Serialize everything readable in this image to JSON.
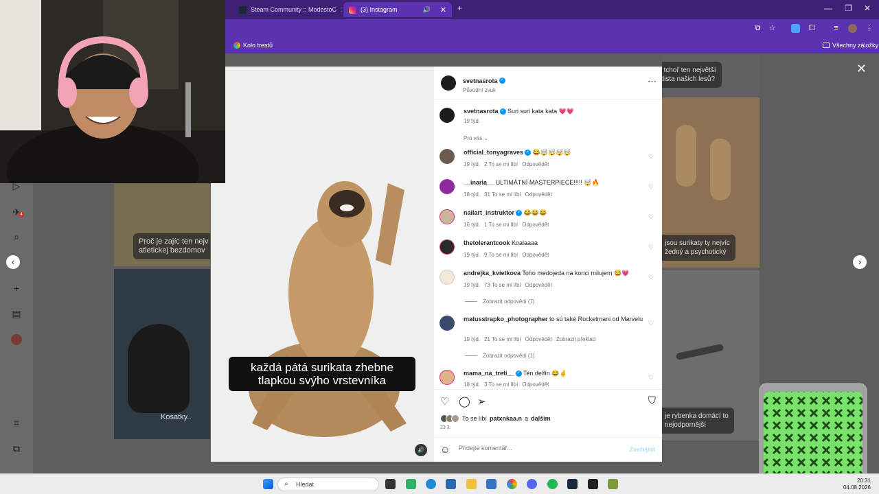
{
  "browser": {
    "tabs": [
      {
        "label": "Steam Community :: ModestoC",
        "active": false,
        "icon": "steam-icon"
      },
      {
        "label": "(3) Instagram",
        "active": true,
        "icon": "instagram-icon"
      }
    ],
    "new_tab_symbol": "+",
    "bookmark_item": "Kolo trestů",
    "all_bookmarks": "Všechny záložky",
    "accent_color": "#5b33b0"
  },
  "background": {
    "captions": [
      "je tchoř ten největší\nadista našich lesů?",
      "Proč je zajíc ten nejv\natletickej bezdomov",
      "jsou surikaty ty nejvíc\nžedný a psychotický",
      "Kosatky..",
      "je rybenka domácí to\nnejodpornější"
    ],
    "notif_count": "4"
  },
  "post": {
    "username": "svetnasrota",
    "audio": "Původní zvuk",
    "subtitle": "každá pátá surikata zhebne tlapkou svýho vrstevníka",
    "caption_text": "Suri suri kata kata 💗💗",
    "caption_time": "19 týd.",
    "filter_label": "Pro vás",
    "comments": [
      {
        "user": "official_tonyagraves",
        "verified": true,
        "text": "😂🤯🤯🤯🤯",
        "time": "19 týd.",
        "likes": "2 To se mi líbí",
        "reply": "Odpovědět",
        "extra": ""
      },
      {
        "user": "__inaria__",
        "verified": false,
        "text": "ULTIMÁTNÍ MASTERPIECE!!!!! 🤯🔥",
        "time": "18 týd.",
        "likes": "31 To se mi líbí",
        "reply": "Odpovědět",
        "extra": ""
      },
      {
        "user": "nailart_instruktor",
        "verified": true,
        "text": "😂😂😂",
        "time": "16 týd.",
        "likes": "1 To se mi líbí",
        "reply": "Odpovědět",
        "extra": ""
      },
      {
        "user": "thetolerantcook",
        "verified": false,
        "text": "Koalaaaa",
        "time": "19 týd.",
        "likes": "9 To se mi líbí",
        "reply": "Odpovědět",
        "extra": ""
      },
      {
        "user": "andrejka_kvietkova",
        "verified": false,
        "text": "Toho medojeda na konci milujem 😂💗",
        "time": "19 týd.",
        "likes": "73 To se mi líbí",
        "reply": "Odpovědět",
        "extra": ""
      },
      {
        "user": "matusstrapko_photographer",
        "verified": false,
        "text": "to sú také Rocketmani od Marvelu",
        "time": "19 týd.",
        "likes": "21 To se mi líbí",
        "reply": "Odpovědět",
        "extra": "Zobrazit překlad"
      },
      {
        "user": "mama_na_treti__",
        "verified": true,
        "text": "Ten delfín 😂🤞",
        "time": "18 týd.",
        "likes": "3 To se mi líbí",
        "reply": "Odpovědět",
        "extra": ""
      }
    ],
    "view_replies": [
      "Zobrazit odpovědi (7)",
      "Zobrazit odpovědi (1)"
    ],
    "liked_by_prefix": "To se líbí",
    "liked_by_user": "patxnkaa.n",
    "liked_by_and": "a",
    "liked_by_others": "dalším",
    "post_date": "23 3.",
    "comment_placeholder": "Přidejte komentář...",
    "publish_label": "Zveřejnit"
  },
  "taskbar": {
    "search_placeholder": "Hledat",
    "time": "20:31",
    "date": "04.08.2026"
  }
}
